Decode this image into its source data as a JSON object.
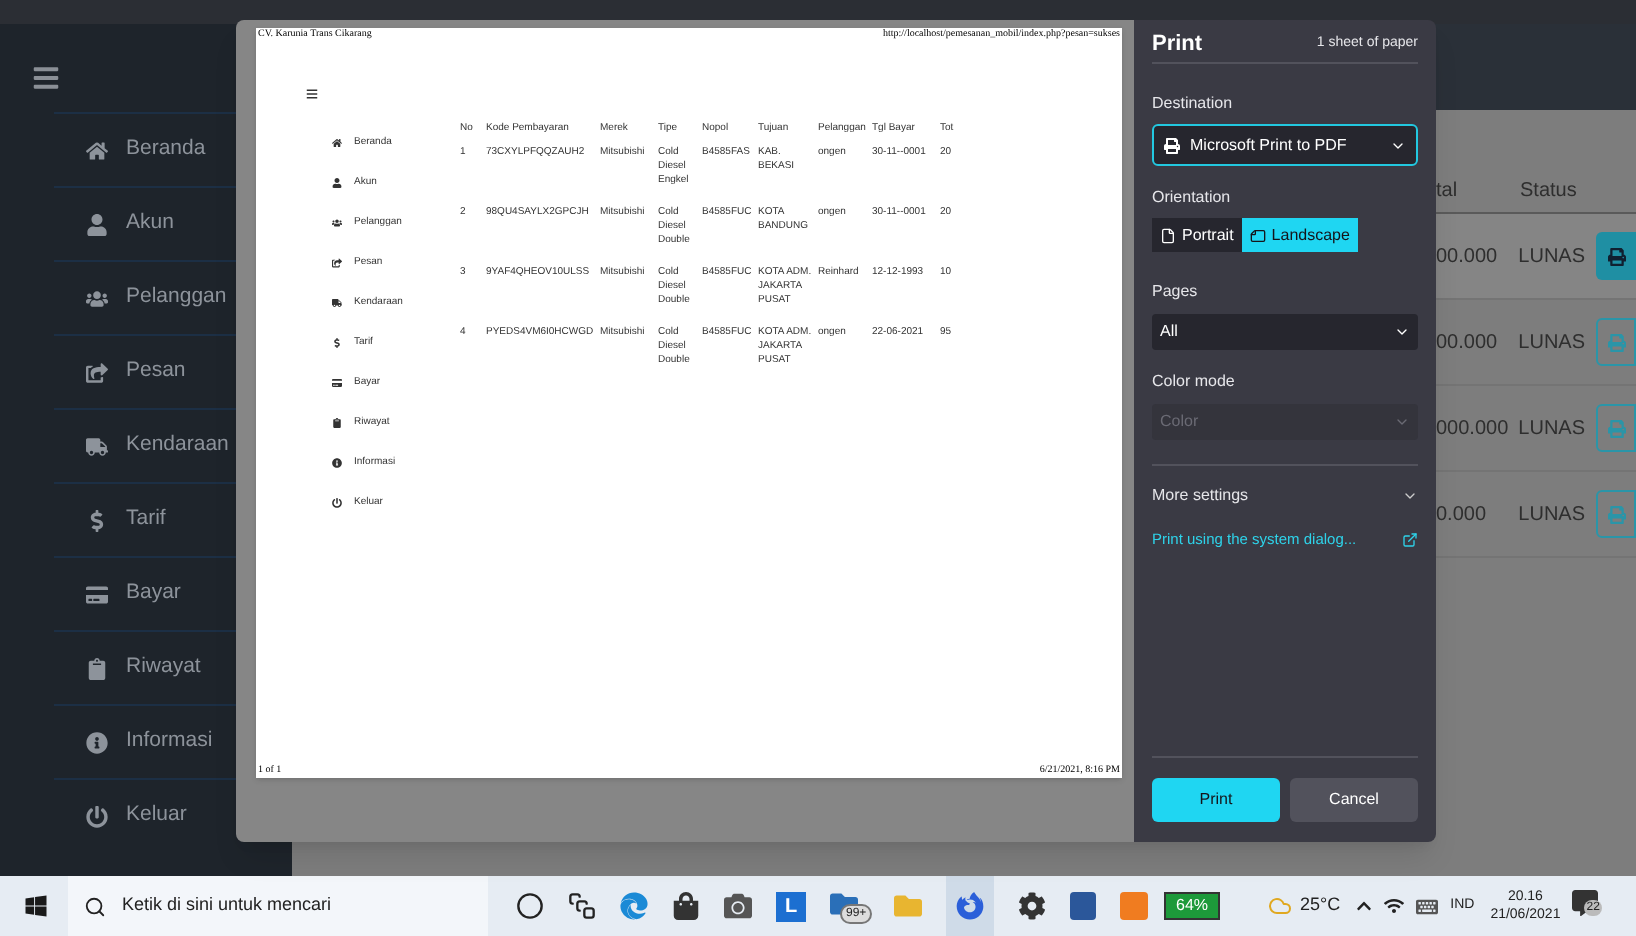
{
  "sidebar": {
    "items": [
      {
        "label": "Beranda"
      },
      {
        "label": "Akun"
      },
      {
        "label": "Pelanggan"
      },
      {
        "label": "Pesan"
      },
      {
        "label": "Kendaraan"
      },
      {
        "label": "Tarif"
      },
      {
        "label": "Bayar"
      },
      {
        "label": "Riwayat"
      },
      {
        "label": "Informasi"
      },
      {
        "label": "Keluar"
      }
    ]
  },
  "table": {
    "columns": [
      "tal",
      "Status"
    ],
    "rows": [
      {
        "total": "00.000",
        "status": "LUNAS",
        "highlighted": true
      },
      {
        "total": "00.000",
        "status": "LUNAS",
        "highlighted": false
      },
      {
        "total": "000.000",
        "status": "LUNAS",
        "highlighted": false
      },
      {
        "total": "0.000",
        "status": "LUNAS",
        "highlighted": false
      }
    ]
  },
  "print_preview": {
    "header_left": "CV. Karunia Trans Cikarang",
    "header_right": "http://localhost/pemesanan_mobil/index.php?pesan=sukses",
    "menu": [
      "Beranda",
      "Akun",
      "Pelanggan",
      "Pesan",
      "Kendaraan",
      "Tarif",
      "Bayar",
      "Riwayat",
      "Informasi",
      "Keluar"
    ],
    "table": {
      "columns": [
        "No",
        "Kode Pembayaran",
        "Merek",
        "Tipe",
        "Nopol",
        "Tujuan",
        "Pelanggan",
        "Tgl Bayar",
        "Tot"
      ],
      "rows": [
        [
          "1",
          "73CXYLPFQQZAUH2",
          "Mitsubishi",
          "Cold Diesel Engkel",
          "B4585FAS",
          "KAB. BEKASI",
          "ongen",
          "30-11--0001",
          "20"
        ],
        [
          "2",
          "98QU4SAYLX2GPCJH",
          "Mitsubishi",
          "Cold Diesel Double",
          "B4585FUC",
          "KOTA BANDUNG",
          "ongen",
          "30-11--0001",
          "20"
        ],
        [
          "3",
          "9YAF4QHEOV10ULSS",
          "Mitsubishi",
          "Cold Diesel Double",
          "B4585FUC",
          "KOTA ADM. JAKARTA PUSAT",
          "Reinhard",
          "12-12-1993",
          "10"
        ],
        [
          "4",
          "PYEDS4VM6I0HCWGD",
          "Mitsubishi",
          "Cold Diesel Double",
          "B4585FUC",
          "KOTA ADM. JAKARTA PUSAT",
          "ongen",
          "22-06-2021",
          "95"
        ]
      ]
    },
    "footer_left": "1 of 1",
    "footer_right": "6/21/2021, 8:16 PM"
  },
  "print_panel": {
    "title": "Print",
    "sheets": "1 sheet of paper",
    "destination": {
      "label": "Destination",
      "value": "Microsoft Print to PDF"
    },
    "orientation": {
      "label": "Orientation",
      "options": [
        {
          "label": "Portrait",
          "selected": false
        },
        {
          "label": "Landscape",
          "selected": true
        }
      ]
    },
    "pages": {
      "label": "Pages",
      "value": "All"
    },
    "color_mode": {
      "label": "Color mode",
      "value": "Color",
      "disabled": true
    },
    "more_settings": "More settings",
    "system_dialog_link": "Print using the system dialog...",
    "buttons": [
      {
        "label": "Print",
        "kind": "primary"
      },
      {
        "label": "Cancel",
        "kind": "secondary"
      }
    ]
  },
  "taskbar": {
    "search_placeholder": "Ketik di sini untuk mencari",
    "app_tile_letter": "L",
    "mail_badge": "99+",
    "battery": "64%",
    "weather": "25°C",
    "language": "IND",
    "time": "20.16",
    "date": "21/06/2021",
    "notifications": "22"
  }
}
